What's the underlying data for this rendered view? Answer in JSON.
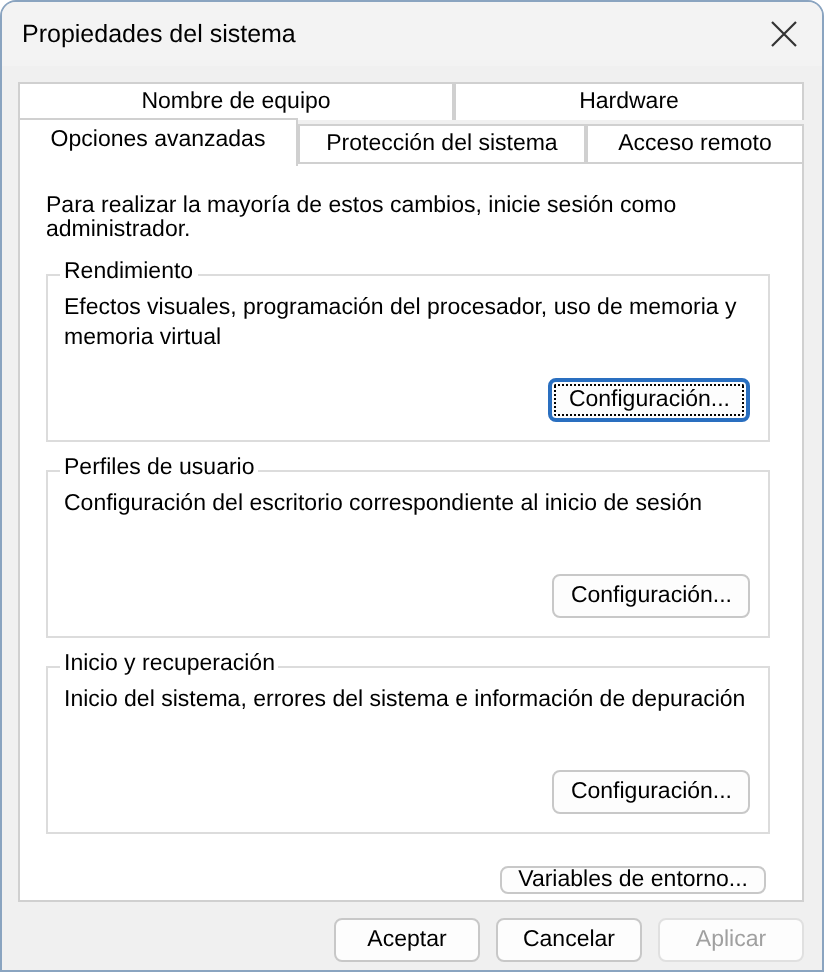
{
  "window": {
    "title": "Propiedades del sistema"
  },
  "tab_rows": [
    [
      {
        "label": "Nombre de equipo",
        "selected": false
      },
      {
        "label": "Hardware",
        "selected": false
      }
    ],
    [
      {
        "label": "Opciones avanzadas",
        "selected": true
      },
      {
        "label": "Protección del sistema",
        "selected": false
      },
      {
        "label": "Acceso remoto",
        "selected": false
      }
    ]
  ],
  "notice": "Para realizar la mayoría de estos cambios, inicie sesión como administrador.",
  "groups": [
    {
      "title": "Rendimiento",
      "description": "Efectos visuales, programación del procesador, uso de memoria y memoria virtual",
      "button": {
        "label": "Configuración...",
        "focused": true
      }
    },
    {
      "title": "Perfiles de usuario",
      "description": "Configuración del escritorio correspondiente al inicio de sesión",
      "button": {
        "label": "Configuración...",
        "focused": false
      }
    },
    {
      "title": "Inicio y recuperación",
      "description": "Inicio del sistema, errores del sistema e información de depuración",
      "button": {
        "label": "Configuración...",
        "focused": false
      }
    }
  ],
  "environment_button": {
    "label": "Variables de entorno..."
  },
  "dialog_buttons": [
    {
      "label": "Aceptar",
      "disabled": false
    },
    {
      "label": "Cancelar",
      "disabled": false
    },
    {
      "label": "Aplicar",
      "disabled": true
    }
  ]
}
